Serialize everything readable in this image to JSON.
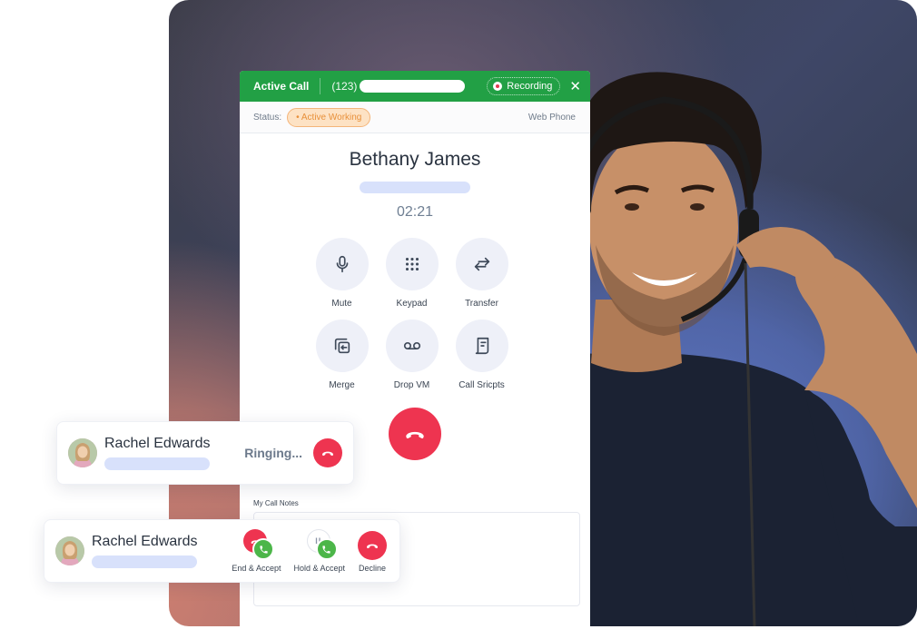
{
  "colors": {
    "brand_green": "#22a045",
    "hangup_red": "#ee3450",
    "accept_green": "#4cb649",
    "status_orange": "#e8903a",
    "placeholder_blue": "#d8e1fb"
  },
  "active_call": {
    "header": {
      "title": "Active Call",
      "number_prefix": "(123)",
      "recording_label": "Recording",
      "close_icon": "close-icon"
    },
    "status": {
      "label": "Status:",
      "value": "• Active Working",
      "mode": "Web Phone"
    },
    "caller": {
      "name": "Bethany James",
      "timer": "02:21"
    },
    "actions": [
      {
        "label": "Mute",
        "icon": "microphone-icon"
      },
      {
        "label": "Keypad",
        "icon": "keypad-icon"
      },
      {
        "label": "Transfer",
        "icon": "transfer-icon"
      },
      {
        "label": "Merge",
        "icon": "merge-icon"
      },
      {
        "label": "Drop VM",
        "icon": "voicemail-icon"
      },
      {
        "label": "Call Sricpts",
        "icon": "script-icon"
      }
    ],
    "hangup_icon": "phone-hangup-icon",
    "notes": {
      "label": "My Call Notes"
    }
  },
  "ringing_card": {
    "name": "Rachel Edwards",
    "status": "Ringing...",
    "hangup_icon": "phone-hangup-icon"
  },
  "incoming_card": {
    "name": "Rachel Edwards",
    "actions": [
      {
        "label": "End & Accept"
      },
      {
        "label": "Hold & Accept",
        "hold_glyph": "II"
      },
      {
        "label": "Decline"
      }
    ]
  }
}
